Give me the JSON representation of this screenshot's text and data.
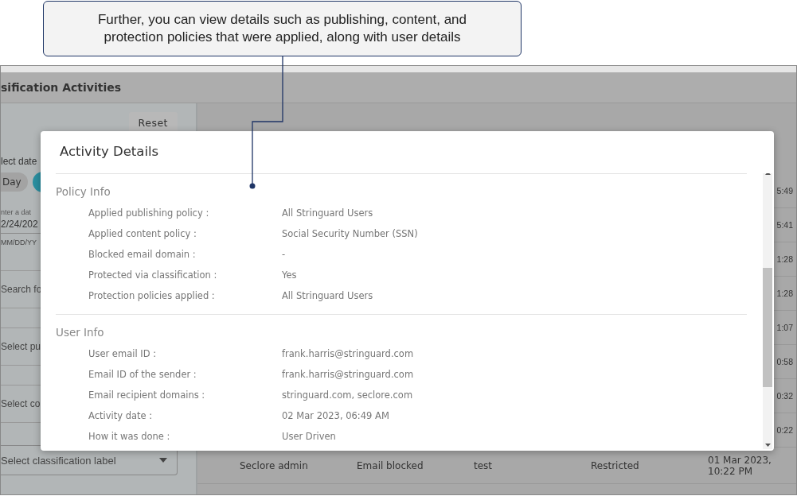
{
  "callout": {
    "lines": [
      "Further, you can view details such as publishing, content, and",
      "protection policies that were applied, along with user details"
    ]
  },
  "app": {
    "title": "sification Activities",
    "reset_button": "Reset",
    "date_label": "lect date",
    "range_option": "Day",
    "date_field": {
      "label": "nter a dat",
      "value": "2/24/202",
      "hint": "MM/DD/YY"
    },
    "search_field": {
      "placeholder": "Search fo"
    },
    "publishing_select": {
      "placeholder": "Select pu"
    },
    "content_select": {
      "placeholder": "Select co"
    },
    "classification_select": {
      "placeholder": "Select classification label"
    }
  },
  "table": {
    "covered_rows": [
      "5:49",
      "5:41",
      "1:28",
      "1:28",
      "1:07",
      "0:58",
      "0:32",
      "0:22"
    ],
    "rows": [
      {
        "cells": [
          "Seclore admin",
          "Email blocked",
          "test",
          "Restricted",
          "01 Mar 2023, 10:22 PM"
        ]
      }
    ]
  },
  "modal": {
    "title": "Activity Details",
    "sections": [
      {
        "title": "Policy Info",
        "fields": [
          {
            "label": "Applied publishing policy :",
            "value": "All Stringuard Users"
          },
          {
            "label": "Applied content policy :",
            "value": "Social Security Number (SSN)"
          },
          {
            "label": "Blocked email domain :",
            "value": "-"
          },
          {
            "label": "Protected via classification :",
            "value": "Yes"
          },
          {
            "label": "Protection policies applied :",
            "value": "All Stringuard Users"
          }
        ]
      },
      {
        "title": "User Info",
        "fields": [
          {
            "label": "User email ID :",
            "value": "frank.harris@stringuard.com"
          },
          {
            "label": "Email ID of the sender :",
            "value": "frank.harris@stringuard.com"
          },
          {
            "label": "Email recipient domains :",
            "value": "stringuard.com, seclore.com"
          },
          {
            "label": "Activity date :",
            "value": "02 Mar 2023, 06:49 AM"
          },
          {
            "label": "How it was done :",
            "value": "User Driven"
          }
        ]
      }
    ]
  }
}
